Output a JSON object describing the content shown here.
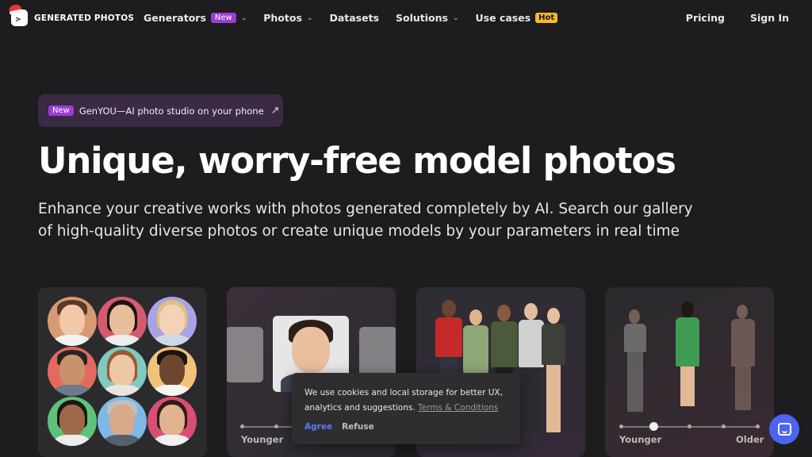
{
  "brand": {
    "name": "GENERATED PHOTOS"
  },
  "nav": {
    "items": [
      {
        "label": "Generators",
        "badge": "New",
        "has_dropdown": true
      },
      {
        "label": "Photos",
        "has_dropdown": true
      },
      {
        "label": "Datasets"
      },
      {
        "label": "Solutions",
        "has_dropdown": true
      },
      {
        "label": "Use cases",
        "badge": "Hot"
      }
    ],
    "right": {
      "pricing": "Pricing",
      "sign_in": "Sign In"
    }
  },
  "promo": {
    "badge": "New",
    "text": "GenYOU—AI photo studio on your phone",
    "icon": "arrow-up-right-icon"
  },
  "hero": {
    "title": "Unique, worry-free model photos",
    "subtitle": "Enhance your creative works with photos generated completely by AI. Search our gallery of high-quality diverse photos or create unique models by your parameters in real time"
  },
  "cards": {
    "face_generator": {
      "slider": {
        "left": "Younger"
      }
    },
    "full_body": {
      "slider": {
        "left": "Younger",
        "right": "Older"
      }
    }
  },
  "cookie": {
    "text": "We use cookies and local storage for better UX, analytics and suggestions.",
    "link": "Terms & Conditions",
    "agree": "Agree",
    "refuse": "Refuse"
  },
  "colors": {
    "background": "#1d1d1f",
    "accent_purple": "#9b3cd8",
    "hot_yellow": "#f5b82e",
    "agree_blue": "#5b7cf5",
    "chat_blue": "#4b64f2"
  },
  "chat": {
    "icon": "chat-bubble-icon"
  }
}
